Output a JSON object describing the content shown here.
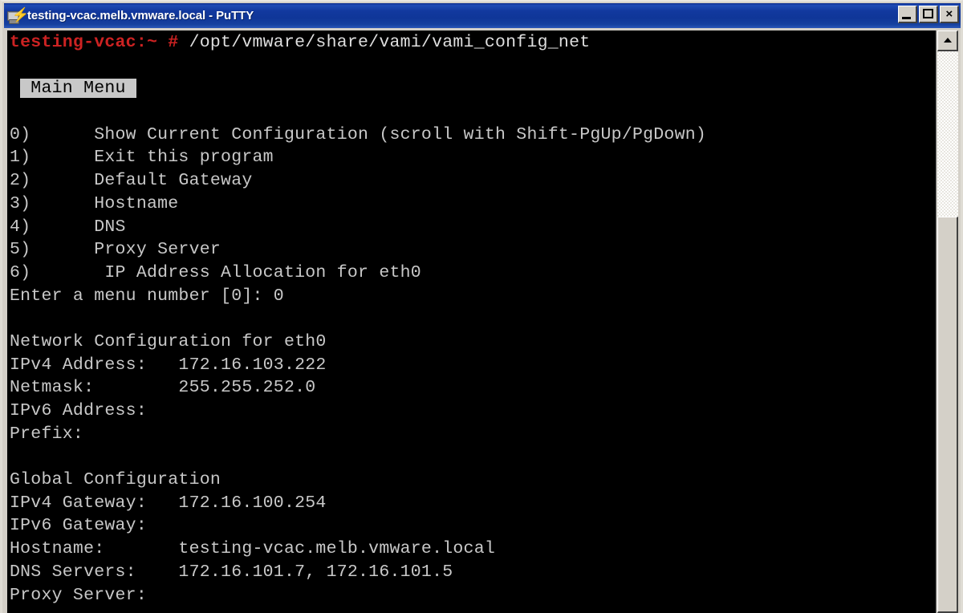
{
  "window": {
    "title": "testing-vcac.melb.vmware.local - PuTTY",
    "icon": "putty-icon",
    "minimize_label": "",
    "maximize_label": "",
    "close_label": "×"
  },
  "terminal": {
    "prompt": "testing-vcac:~ #",
    "command": " /opt/vmware/share/vami/vami_config_net",
    "blank": "",
    "menu_header": " Main Menu ",
    "menu_items": [
      "0)      Show Current Configuration (scroll with Shift-PgUp/PgDown)",
      "1)      Exit this program",
      "2)      Default Gateway",
      "3)      Hostname",
      "4)      DNS",
      "5)      Proxy Server",
      "6)       IP Address Allocation for eth0"
    ],
    "menu_prompt": "Enter a menu number [0]: 0",
    "network_section_title": "Network Configuration for eth0",
    "network_rows": [
      "IPv4 Address:   172.16.103.222",
      "Netmask:        255.255.252.0",
      "IPv6 Address:",
      "Prefix:"
    ],
    "global_section_title": "Global Configuration",
    "global_rows": [
      "IPv4 Gateway:   172.16.100.254",
      "IPv6 Gateway:",
      "Hostname:       testing-vcac.melb.vmware.local",
      "DNS Servers:    172.16.101.7, 172.16.101.5",
      "Proxy Server:"
    ],
    "colors": {
      "background": "#000000",
      "foreground": "#c8c8c8",
      "prompt": "#cc2222",
      "reverse_bg": "#c8c8c8",
      "reverse_fg": "#000000"
    }
  },
  "scrollbar": {
    "up_arrow": "scroll-up-arrow",
    "thumb": "scroll-thumb"
  }
}
